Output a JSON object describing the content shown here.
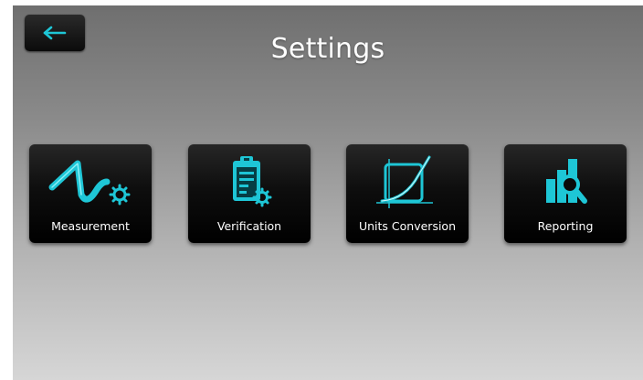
{
  "header": {
    "title": "Settings",
    "back_icon": "arrow-left-icon"
  },
  "tiles": [
    {
      "label": "Measurement",
      "icon": "waveform-gear-icon"
    },
    {
      "label": "Verification",
      "icon": "clipboard-gear-icon"
    },
    {
      "label": "Units Conversion",
      "icon": "curve-graph-icon"
    },
    {
      "label": "Reporting",
      "icon": "bar-chart-magnifier-icon"
    }
  ],
  "colors": {
    "accent": "#1ec6d6",
    "tile_background": "#0e0e0e",
    "text": "#ffffff"
  }
}
